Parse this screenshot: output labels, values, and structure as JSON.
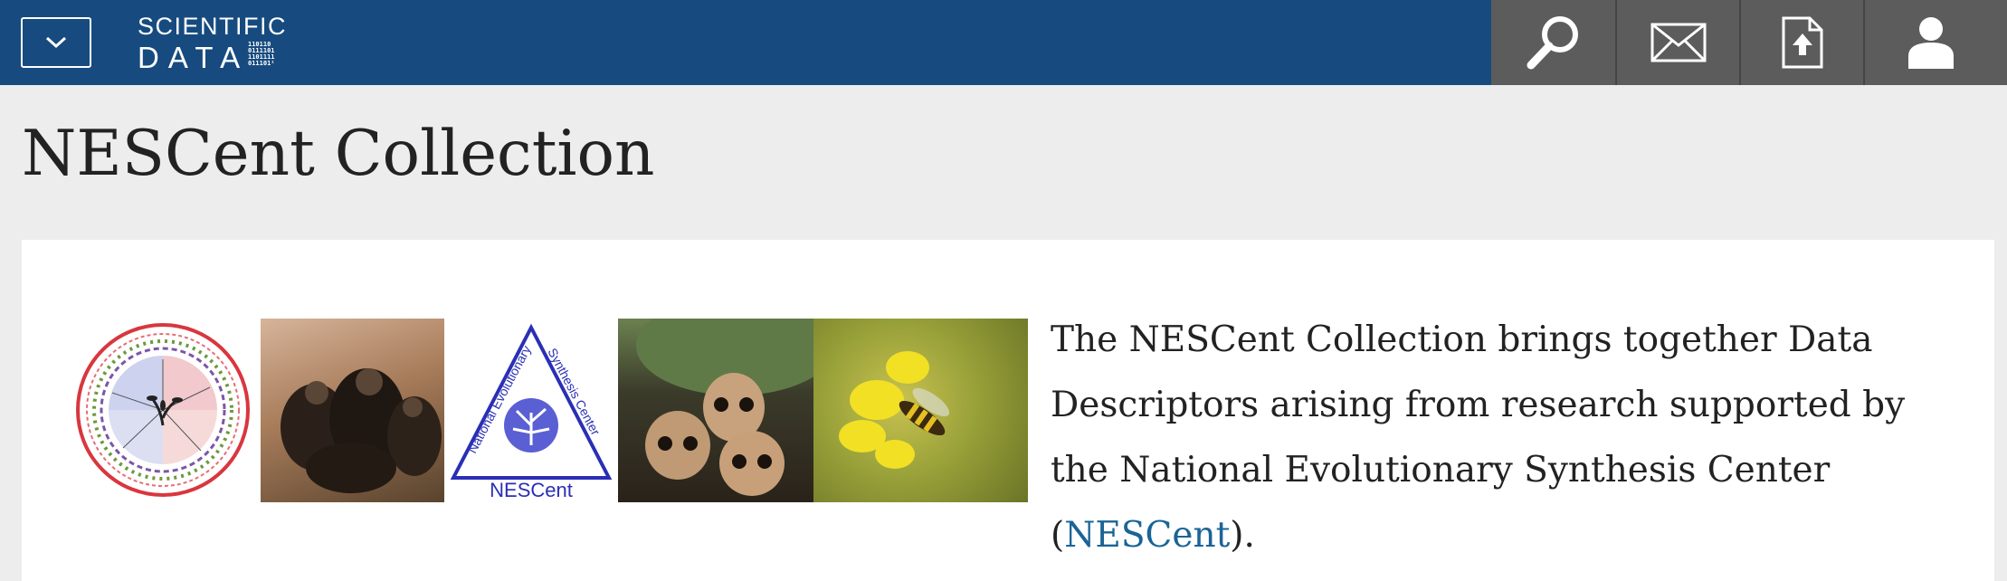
{
  "header": {
    "logo_line1": "SCIENTIFIC",
    "logo_line2": "DATA",
    "logo_binary": "110110\n0111101\n1101111\n011101¹",
    "menu_icon": "chevron-down-icon",
    "actions": [
      {
        "name": "search",
        "icon": "search-icon"
      },
      {
        "name": "contact",
        "icon": "envelope-icon"
      },
      {
        "name": "submit",
        "icon": "upload-document-icon"
      },
      {
        "name": "account",
        "icon": "user-icon"
      }
    ],
    "colors": {
      "bar": "#174b7f",
      "toolbar": "#5c5c5c"
    }
  },
  "page": {
    "title": "NESCent Collection"
  },
  "banner": {
    "logo_arc_left": "National Evolutionary",
    "logo_arc_right": "Synthesis Center",
    "logo_label": "NESCent"
  },
  "description": {
    "text_before": "The NESCent Collection brings together Data Descriptors arising from research supported by the National Evolutionary Synthesis Center (",
    "link_text": "NESCent",
    "text_after": ").",
    "link_color": "#1a6496"
  }
}
